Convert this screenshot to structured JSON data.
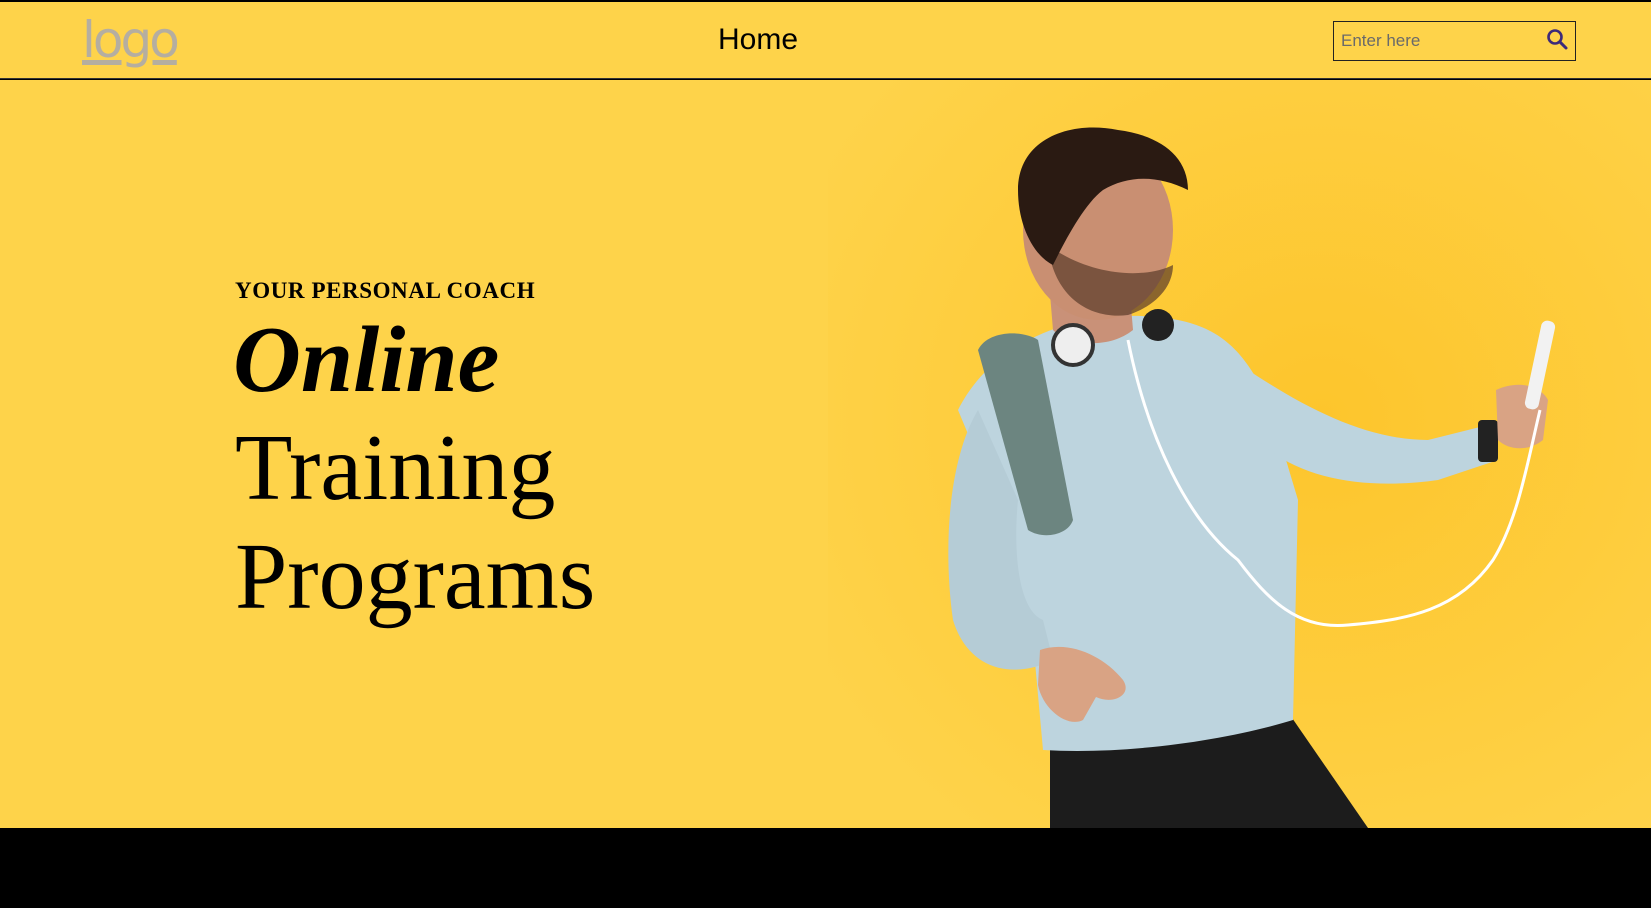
{
  "header": {
    "logo_text": "logo",
    "nav": [
      {
        "label": "Home"
      }
    ],
    "search": {
      "placeholder": "Enter here",
      "value": "",
      "icon": "search-icon"
    }
  },
  "hero": {
    "eyebrow": "YOUR PERSONAL COACH",
    "headline_lines": [
      "Online",
      "Training",
      "Programs"
    ],
    "image": "man-in-athletic-shirt-with-headphones-and-towel-looking-at-phone"
  },
  "colors": {
    "background": "#fed34a",
    "footer": "#000000",
    "logo": "#b5aea0",
    "search_icon": "#3d2a7a"
  }
}
